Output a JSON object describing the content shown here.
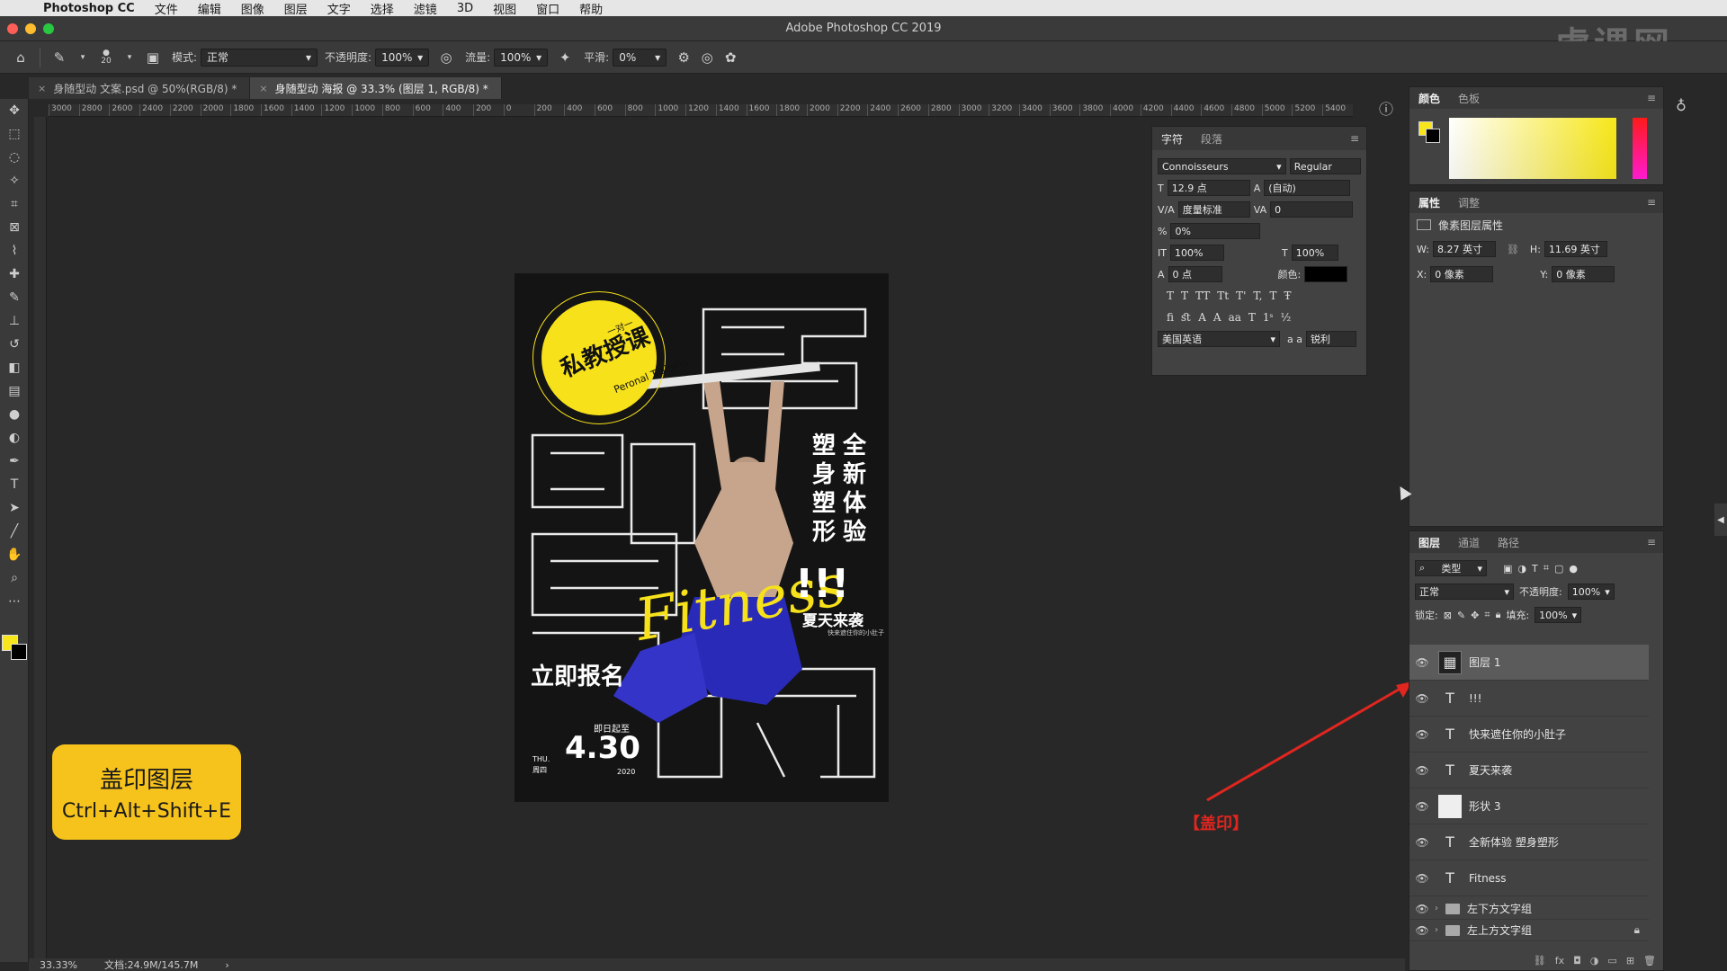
{
  "menubar": {
    "app": "Photoshop CC",
    "items": [
      "文件",
      "编辑",
      "图像",
      "图层",
      "文字",
      "选择",
      "滤镜",
      "3D",
      "视图",
      "窗口",
      "帮助"
    ]
  },
  "window": {
    "title": "Adobe Photoshop CC 2019",
    "watermark": "虎课网"
  },
  "options": {
    "brush_size": "20",
    "mode_label": "模式:",
    "mode_value": "正常",
    "opacity_label": "不透明度:",
    "opacity_value": "100%",
    "flow_label": "流量:",
    "flow_value": "100%",
    "smooth_label": "平滑:",
    "smooth_value": "0%"
  },
  "tabs": [
    {
      "label": "身随型动 文案.psd @ 50%(RGB/8) *"
    },
    {
      "label": "身随型动 海报 @ 33.3% (图层 1, RGB/8) *"
    }
  ],
  "ruler_labels": [
    "3000",
    "2800",
    "2600",
    "2400",
    "2200",
    "2000",
    "1800",
    "1600",
    "1400",
    "1200",
    "1000",
    "800",
    "600",
    "400",
    "200",
    "0",
    "200",
    "400",
    "600",
    "800",
    "1000",
    "1200",
    "1400",
    "1600",
    "1800",
    "2000",
    "2200",
    "2400",
    "2600",
    "2800",
    "3000",
    "3200",
    "3400",
    "3600",
    "3800",
    "4000",
    "4200",
    "4400",
    "4600",
    "4800",
    "5000",
    "5200",
    "5400"
  ],
  "poster": {
    "badge_top": "一对一",
    "badge_main": "私教授课",
    "badge_en": "Peronal Training",
    "vert_col1": "塑身塑形",
    "vert_col2": "全新体验",
    "fitness": "Fitness",
    "bang": "!!!",
    "summer": "夏天来袭",
    "small": "快来遮住你的小肚子",
    "signup": "立即报名",
    "from": "即日起至",
    "date": "4.30",
    "thu": "THU.",
    "weekday": "周四",
    "year": "2020"
  },
  "shortcut": {
    "title": "盖印图层",
    "keys": "Ctrl+Alt+Shift+E"
  },
  "annotation": {
    "label": "【盖印】"
  },
  "character_panel": {
    "tabs": [
      "字符",
      "段落"
    ],
    "font_family": "Connoisseurs",
    "font_style": "Regular",
    "font_size": "12.9 点",
    "leading": "(自动)",
    "kerning": "度量标准",
    "tracking": "0",
    "tsume": "0%",
    "vscale": "100%",
    "hscale": "100%",
    "baseline": "0 点",
    "color_label": "颜色:",
    "language": "美国英语",
    "aa_label": "a a",
    "antialias": "锐利"
  },
  "color_panel": {
    "tabs": [
      "颜色",
      "色板"
    ],
    "fg": "#f8e61c",
    "bg": "#000000"
  },
  "properties_panel": {
    "tabs": [
      "属性",
      "调整"
    ],
    "title": "像素图层属性",
    "w_label": "W:",
    "w_value": "8.27 英寸",
    "h_label": "H:",
    "h_value": "11.69 英寸",
    "x_label": "X:",
    "x_value": "0 像素",
    "y_label": "Y:",
    "y_value": "0 像素"
  },
  "layers_panel": {
    "tabs": [
      "图层",
      "通道",
      "路径"
    ],
    "filter": "类型",
    "blend": "正常",
    "opacity_label": "不透明度:",
    "opacity": "100%",
    "lock_label": "锁定:",
    "fill_label": "填充:",
    "fill": "100%",
    "layers": [
      {
        "name": "图层 1",
        "kind": "image",
        "selected": true
      },
      {
        "name": "!!!",
        "kind": "text"
      },
      {
        "name": "快来遮住你的小肚子",
        "kind": "text"
      },
      {
        "name": "夏天来袭",
        "kind": "text"
      },
      {
        "name": "形状 3",
        "kind": "shape"
      },
      {
        "name": "全新体验 塑身塑形",
        "kind": "text"
      },
      {
        "name": "Fitness",
        "kind": "text"
      },
      {
        "name": "左下方文字组",
        "kind": "group"
      },
      {
        "name": "左上方文字组",
        "kind": "group",
        "locked": true
      }
    ],
    "bottom_icons": [
      "link-icon",
      "fx-icon",
      "mask-icon",
      "adjustment-icon",
      "group-icon",
      "new-layer-icon",
      "trash-icon"
    ]
  },
  "status": {
    "zoom": "33.33%",
    "doc": "文档:24.9M/145.7M"
  }
}
